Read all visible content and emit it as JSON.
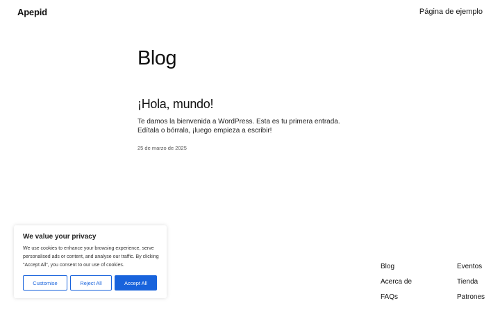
{
  "header": {
    "site_title": "Apepid",
    "nav_link": "Página de ejemplo"
  },
  "main": {
    "heading": "Blog",
    "post": {
      "title": "¡Hola, mundo!",
      "excerpt": "Te damos la bienvenida a WordPress. Esta es tu primera entrada. Edítala o bórrala, ¡luego empieza a escribir!",
      "date": "25 de marzo de 2025"
    }
  },
  "footer": {
    "col1": [
      "Blog",
      "Acerca de",
      "FAQs"
    ],
    "col2": [
      "Eventos",
      "Tienda",
      "Patrones"
    ]
  },
  "cookie_banner": {
    "title": "We value your privacy",
    "text": "We use cookies to enhance your browsing experience, serve personalised ads or content, and analyse our traffic. By clicking \"Accept All\", you consent to our use of cookies.",
    "customise_label": "Customise",
    "reject_label": "Reject All",
    "accept_label": "Accept All",
    "accent_color": "#1863dc"
  }
}
